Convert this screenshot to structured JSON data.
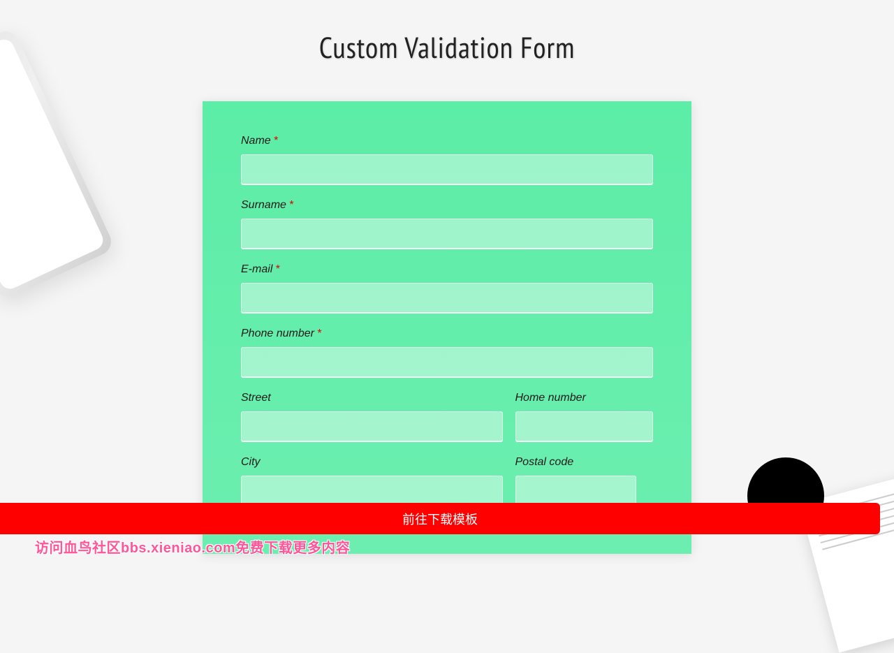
{
  "page": {
    "title": "Custom Validation Form"
  },
  "form": {
    "fields": {
      "name": {
        "label": "Name",
        "required": "*",
        "value": ""
      },
      "surname": {
        "label": "Surname",
        "required": "*",
        "value": ""
      },
      "email": {
        "label": "E-mail",
        "required": "*",
        "value": ""
      },
      "phone": {
        "label": "Phone number",
        "required": "*",
        "value": ""
      },
      "street": {
        "label": "Street",
        "value": ""
      },
      "home_number": {
        "label": "Home number",
        "value": ""
      },
      "city": {
        "label": "City",
        "value": ""
      },
      "postal_code": {
        "label": "Postal code",
        "value": ""
      }
    }
  },
  "download_bar": {
    "label": "前往下载模板"
  },
  "watermark": {
    "text": "访问血鸟社区bbs.xieniao.com免费下载更多内容"
  }
}
